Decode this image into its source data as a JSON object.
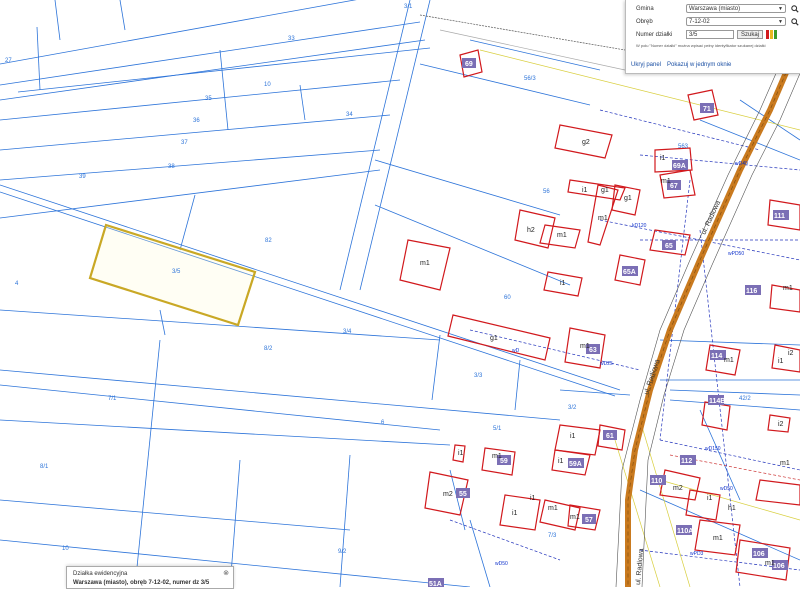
{
  "panel": {
    "gmina_label": "Gmina",
    "gmina_value": "Warszawa (miasto)",
    "obreb_label": "Obręb",
    "obreb_value": "7-12-02",
    "numer_label": "Numer działki",
    "numer_value": "3/5",
    "search_button": "Szukaj",
    "hint": "W polu \"Numer działki\" można wpisać pełny identyfikator szukanej działki",
    "link_hide": "Ukryj panel",
    "link_show_one": "Pokazuj w jednym oknie"
  },
  "info": {
    "title": "Działka ewidencyjna",
    "body": "Warszawa (miasto), obręb 7-12-02, numer dz 3/5",
    "close": "⊗"
  },
  "map": {
    "selected_parcel": "3/5",
    "colors": {
      "parcel_line": "#2d74d9",
      "building": "#d1191d",
      "selected": "#c9a825",
      "road": "#c97a1f",
      "utility": "#1133cc"
    },
    "parcel_labels": [
      "33",
      "10",
      "36",
      "35",
      "34",
      "37",
      "38",
      "39",
      "82",
      "3/5",
      "4",
      "3/4",
      "8/2",
      "60",
      "7/1",
      "3/3",
      "3/2",
      "5/1",
      "6",
      "8/1",
      "10",
      "9/2",
      "7/3",
      "56/3",
      "56",
      "563",
      "42/2",
      "3/1",
      "27"
    ],
    "buildings": [
      "69",
      "71",
      "g2",
      "i1",
      "69A",
      "m1",
      "67",
      "g1",
      "h2",
      "m1",
      "i1",
      "65",
      "m1",
      "65A",
      "i1",
      "g1",
      "m1",
      "63",
      "111",
      "110",
      "114",
      "m1",
      "i2",
      "116",
      "i2",
      "i1",
      "61",
      "m1",
      "59",
      "59A",
      "112",
      "m2",
      "i1",
      "56",
      "i1",
      "m1",
      "57",
      "m2",
      "110A",
      "m1",
      "106",
      "m1",
      "51A"
    ],
    "street": "ul. Radiowa"
  }
}
